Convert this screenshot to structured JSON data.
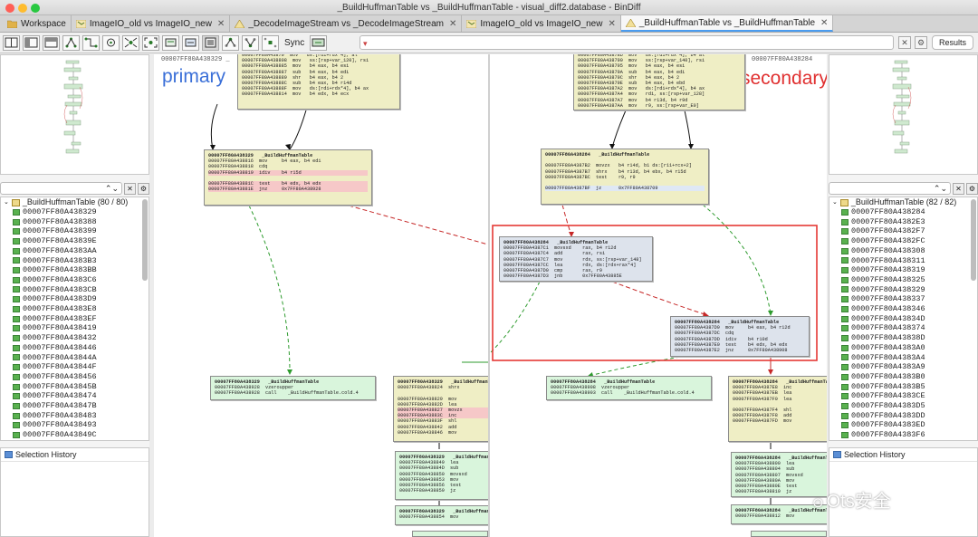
{
  "window": {
    "title": "_BuildHuffmanTable vs _BuildHuffmanTable - visual_diff2.database - BinDiff"
  },
  "tabs": [
    {
      "label": "Workspace",
      "icon": "folder-icon",
      "closable": false,
      "active": false
    },
    {
      "label": "ImageIO_old vs ImageIO_new",
      "icon": "call-graph-icon",
      "closable": true,
      "active": false
    },
    {
      "label": "_DecodeImageStream vs _DecodeImageStream",
      "icon": "flow-graph-icon",
      "closable": true,
      "active": false
    },
    {
      "label": "ImageIO_old vs ImageIO_new",
      "icon": "call-graph-icon",
      "closable": true,
      "active": false
    },
    {
      "label": "_BuildHuffmanTable vs _BuildHuffmanTable",
      "icon": "flow-graph-icon",
      "closable": true,
      "active": true
    }
  ],
  "toolbar": {
    "sync_label": "Sync",
    "results_label": "Results",
    "search_placeholder": "",
    "buttons": [
      "layout-side-by-side-icon",
      "layout-left-icon",
      "layout-top-icon",
      "hierarchic-layout-icon",
      "orthogonal-layout-icon",
      "circular-layout-icon",
      "proximity-icon",
      "fit-graph-icon",
      "zoom-selection-icon",
      "zoom-normal-icon",
      "graph-view-icon",
      "select-ancestors-icon",
      "select-descendants-icon",
      "select-neighbours-icon"
    ]
  },
  "left_panel": {
    "tree_root": "_BuildHuffmanTable (80 / 80)",
    "items": [
      "00007FF80A438329",
      "00007FF80A438388",
      "00007FF80A438399",
      "00007FF80A43839E",
      "00007FF80A4383AA",
      "00007FF80A4383B3",
      "00007FF80A4383BB",
      "00007FF80A4383C6",
      "00007FF80A4383CB",
      "00007FF80A4383D9",
      "00007FF80A4383E8",
      "00007FF80A4383EF",
      "00007FF80A438419",
      "00007FF80A438432",
      "00007FF80A438446",
      "00007FF80A43844A",
      "00007FF80A43844F",
      "00007FF80A438456",
      "00007FF80A43845B",
      "00007FF80A438474",
      "00007FF80A43847B",
      "00007FF80A438483",
      "00007FF80A438493",
      "00007FF80A43849C"
    ],
    "history_label": "Selection History"
  },
  "right_panel": {
    "tree_root": "_BuildHuffmanTable (82 / 82)",
    "items": [
      "00007FF80A438284",
      "00007FF80A4382E3",
      "00007FF80A4382F7",
      "00007FF80A4382FC",
      "00007FF80A438308",
      "00007FF80A438311",
      "00007FF80A438319",
      "00007FF80A438325",
      "00007FF80A438329",
      "00007FF80A438337",
      "00007FF80A438346",
      "00007FF80A43834D",
      "00007FF80A438374",
      "00007FF80A43838D",
      "00007FF80A4383A0",
      "00007FF80A4383A4",
      "00007FF80A4383A9",
      "00007FF80A4383B0",
      "00007FF80A4383B5",
      "00007FF80A4383CE",
      "00007FF80A4383D5",
      "00007FF80A4383DD",
      "00007FF80A4383ED",
      "00007FF80A4383F6"
    ],
    "history_label": "Selection History"
  },
  "primary": {
    "label": "primary",
    "header_addr": "00007FF80A438329 _",
    "top_block": [
      "00007FF80A43870  mov   ds:[rdi+rdx*4], al",
      "00007FF80A438808  mov   ss:[rsp+var_120], rsi",
      "00007FF80A438885  mov   b4 eax, b4 esi",
      "00007FF80A438887  sub   b4 eax, b4 edi",
      "00007FF80A438889  shr   b4 eax, b4 2",
      "00007FF80A43888C  sub   b4 eax, b4 r14d",
      "00007FF80A43888F  mov   ds:[rdi+rdx*4], b4 ax",
      "00007FF80A438814  mov   b4 edx, b4 ecx"
    ],
    "mid_block": [
      "00007FF80A438329   _BuildHuffmanTable",
      "00007FF80A438816  mov     b4 eax, b4 edi",
      "00007FF80A438818  cdq",
      "00007FF80A438819  idiv    b4 r15d",
      "",
      "00007FF80A43881C  test    b4 edx, b4 edx",
      "00007FF80A43881E  jnz     0x7FF80A438928"
    ],
    "cold_block": [
      "00007FF80A438329   _BuildHuffmanTable",
      "00007FF80A438928  vzeroupper",
      "00007FF80A438928  call    _BuildHuffmanTable.cold.4"
    ],
    "right_block": [
      "00007FF80A438329   _BuildHuffmanTable",
      "00007FF80A438824  shrx",
      "",
      "00007FF80A438829  mov",
      "00007FF80A43882D  lea",
      "00007FF80A438827  movzx",
      "00007FF80A43883C  inc",
      "00007FF80A43883F  shl",
      "00007FF80A438842  add",
      "00007FF80A438846  mov"
    ],
    "green_block1": [
      "00007FF80A438329   _BuildHuffmanTable",
      "00007FF80A438849  lea",
      "00007FF80A43884D  sub",
      "00007FF80A438850  movsxd",
      "00007FF80A438853  mov",
      "00007FF80A438856  test",
      "00007FF80A438859  jz"
    ],
    "green_block2": [
      "00007FF80A438329   _BuildHuffmanTable",
      "00007FF80A438854  mov"
    ]
  },
  "secondary": {
    "label": "secondary",
    "header_addr": "00007FF80A438284",
    "top_block": [
      "00007FF80A43878D  mov   ds:[rdi+rdx*4], b4 al",
      "00007FF80A438790  mov   ss:[rsp+var_140], rsi",
      "00007FF80A438795  mov   b4 eax, b4 esi",
      "00007FF80A43879A  sub   b4 eax, b4 edi",
      "00007FF80A43879C  shr   b4 eax, b4 2",
      "00007FF80A43879E  sub   b4 eax, b4 ebd",
      "00007FF80A4387A2  mov   ds:[rdi+rdx*4], b4 ax",
      "00007FF80A4387A4  mov   rdi, ss:[rsp+var_128]",
      "00007FF80A4387A7  mov   b4 r13d, b4 r9d",
      "00007FF80A4387AA  mov   r9, ss:[rsp+var_E0]"
    ],
    "mid_block": [
      "00007FF80A438284   _BuildHuffmanTable",
      "",
      "00007FF80A4387B2  movzx   b4 r14d, b1 ds:[r11+rcx+2]",
      "00007FF80A4387B7  shrx    b4 r13d, b4 ebx, b4 r15d",
      "00007FF80A4387BC  test    r9, r9",
      "",
      "00007FF80A4387BF  jz      0x7FF80A438709"
    ],
    "new_block": [
      "00007FF80A438284   _BuildHuffmanTable",
      "00007FF80A4387C1  movsxd    rax, b4 r12d",
      "00007FF80A4387C4  add       rax, rsi",
      "00007FF80A4387C7  mov       rdx, ss:[rsp+var_148]",
      "00007FF80A4387CC  lea       rdx, ds:[rdx+rax*4]",
      "00007FF80A4387D0  cmp       rax, r9",
      "00007FF80A4387D3  jnb       0x7FF80A43885E"
    ],
    "blue_block": [
      "00007FF80A438284   _BuildHuffmanTable",
      "00007FF80A4387D9  mov     b4 eax, b4 r12d",
      "00007FF80A4387DC  cdq",
      "00007FF80A4387DD  idiv    b4 r10d",
      "00007FF80A4387E0  test    b4 edx, b4 edx",
      "00007FF80A4387E2  jnz     0x7FF80A438908"
    ],
    "cold_block": [
      "00007FF80A438284   _BuildHuffmanTable",
      "00007FF80A438908  vzeroupper",
      "00007FF80A438903  call    _BuildHuffmanTable.cold.4"
    ],
    "right_block": [
      "00007FF80A438284   _BuildHuffmanTable",
      "00007FF80A4387E8  inc",
      "00007FF80A4387EB  lea",
      "00007FF80A4387F0  lea",
      "",
      "00007FF80A4387F4  shl",
      "00007FF80A4387F8  add",
      "00007FF80A4387FD  mov"
    ],
    "green_block1": [
      "00007FF80A438284   _BuildHuffmanTable",
      "00007FF80A438800  lea",
      "00007FF80A438804  sub",
      "00007FF80A438807  movsxd",
      "00007FF80A43880A  mov",
      "00007FF80A43880E  test",
      "00007FF80A438810  jz"
    ],
    "green_block2": [
      "00007FF80A438284   _BuildHuffmanTable",
      "00007FF80A438812  mov"
    ]
  },
  "watermark": "Ots安全",
  "colors": {
    "primary_label": "#3a6fd8",
    "secondary_label": "#e03030",
    "highlight_box": "#e53935",
    "unmatched_edge": "#c62828",
    "matched_edge": "#2e9b2e",
    "accent_tab": "#4a9cf0"
  }
}
